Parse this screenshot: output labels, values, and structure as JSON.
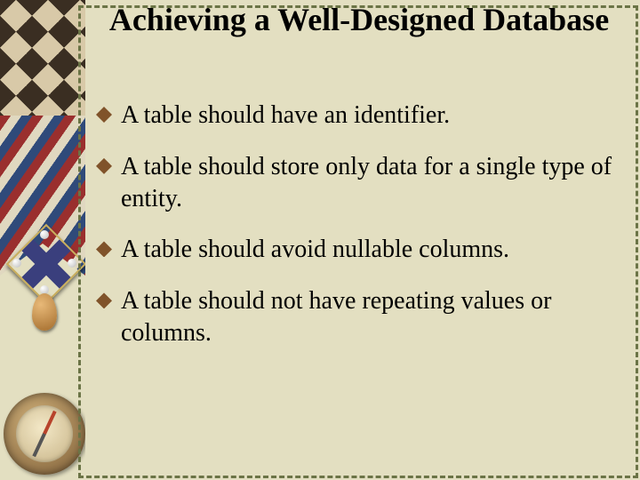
{
  "title": "Achieving a Well-Designed Database",
  "bullets": [
    "A table should have an identifier.",
    "A table should store only data for a single type of entity.",
    "A table should avoid nullable columns.",
    "A table should not have repeating values or columns."
  ]
}
